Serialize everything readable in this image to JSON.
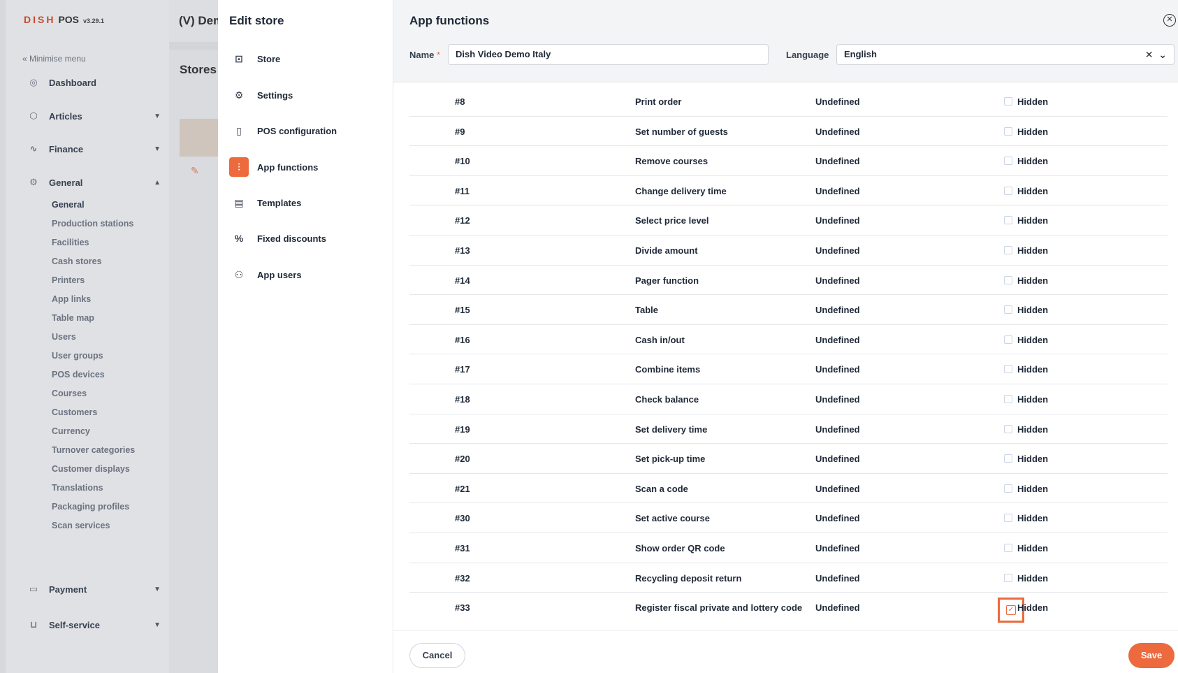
{
  "app": {
    "brand": "DISH",
    "brand_pos": "POS",
    "version": "v3.29.1",
    "header_title": "(V) Dem",
    "minimise": "« Minimise menu"
  },
  "sidebar": {
    "items": [
      {
        "label": "Dashboard",
        "icon": "dashboard-icon"
      },
      {
        "label": "Articles",
        "icon": "cube-icon"
      },
      {
        "label": "Finance",
        "icon": "pulse-icon"
      },
      {
        "label": "General",
        "icon": "gear-icon"
      },
      {
        "label": "Payment",
        "icon": "card-icon"
      },
      {
        "label": "Self-service",
        "icon": "cart-icon"
      }
    ],
    "general_sub": [
      "General",
      "Production stations",
      "Facilities",
      "Cash stores",
      "Printers",
      "App links",
      "Table map",
      "Users",
      "User groups",
      "POS devices",
      "Courses",
      "Customers",
      "Currency",
      "Turnover categories",
      "Customer displays",
      "Translations",
      "Packaging profiles",
      "Scan services"
    ]
  },
  "stores": {
    "title": "Stores"
  },
  "edit_store": {
    "title": "Edit store",
    "menu": [
      {
        "label": "Store",
        "icon": "bag-icon"
      },
      {
        "label": "Settings",
        "icon": "gear-icon"
      },
      {
        "label": "POS configuration",
        "icon": "device-icon"
      },
      {
        "label": "App functions",
        "icon": "sliders-icon"
      },
      {
        "label": "Templates",
        "icon": "template-icon"
      },
      {
        "label": "Fixed discounts",
        "icon": "percent-icon"
      },
      {
        "label": "App users",
        "icon": "user-plus-icon"
      }
    ]
  },
  "app_functions": {
    "title": "App functions",
    "name_label": "Name",
    "name_required": "*",
    "name_value": "Dish Video Demo Italy",
    "language_label": "Language",
    "language_value": "English",
    "rows": [
      {
        "num": "#8",
        "name": "Print order",
        "status": "Undefined",
        "hidden": "Hidden"
      },
      {
        "num": "#9",
        "name": "Set number of guests",
        "status": "Undefined",
        "hidden": "Hidden"
      },
      {
        "num": "#10",
        "name": "Remove courses",
        "status": "Undefined",
        "hidden": "Hidden"
      },
      {
        "num": "#11",
        "name": "Change delivery time",
        "status": "Undefined",
        "hidden": "Hidden"
      },
      {
        "num": "#12",
        "name": "Select price level",
        "status": "Undefined",
        "hidden": "Hidden"
      },
      {
        "num": "#13",
        "name": "Divide amount",
        "status": "Undefined",
        "hidden": "Hidden"
      },
      {
        "num": "#14",
        "name": "Pager function",
        "status": "Undefined",
        "hidden": "Hidden"
      },
      {
        "num": "#15",
        "name": "Table",
        "status": "Undefined",
        "hidden": "Hidden"
      },
      {
        "num": "#16",
        "name": "Cash in/out",
        "status": "Undefined",
        "hidden": "Hidden"
      },
      {
        "num": "#17",
        "name": "Combine items",
        "status": "Undefined",
        "hidden": "Hidden"
      },
      {
        "num": "#18",
        "name": "Check balance",
        "status": "Undefined",
        "hidden": "Hidden"
      },
      {
        "num": "#19",
        "name": "Set delivery time",
        "status": "Undefined",
        "hidden": "Hidden"
      },
      {
        "num": "#20",
        "name": "Set pick-up time",
        "status": "Undefined",
        "hidden": "Hidden"
      },
      {
        "num": "#21",
        "name": "Scan a code",
        "status": "Undefined",
        "hidden": "Hidden"
      },
      {
        "num": "#30",
        "name": "Set active course",
        "status": "Undefined",
        "hidden": "Hidden"
      },
      {
        "num": "#31",
        "name": "Show order QR code",
        "status": "Undefined",
        "hidden": "Hidden"
      },
      {
        "num": "#32",
        "name": "Recycling deposit return",
        "status": "Undefined",
        "hidden": "Hidden"
      },
      {
        "num": "#33",
        "name": "Register fiscal private and lottery code",
        "status": "Undefined",
        "hidden": "Hidden",
        "highlighted": true
      }
    ],
    "cancel_label": "Cancel",
    "save_label": "Save"
  },
  "colors": {
    "accent": "#ec6a3d",
    "brand": "#c64a2e"
  }
}
